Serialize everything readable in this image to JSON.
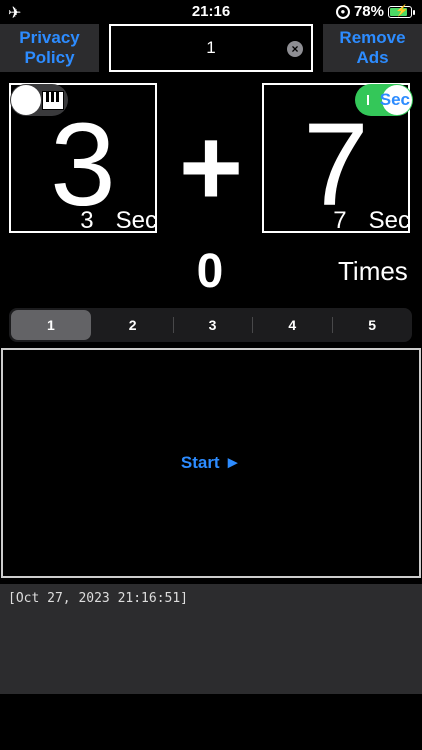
{
  "status_bar": {
    "time": "21:16",
    "battery_percent": "78%"
  },
  "header": {
    "privacy_label": "Privacy Policy",
    "remove_ads_label": "Remove Ads",
    "field_value": "1"
  },
  "left_panel": {
    "number": "3",
    "sub_value": "3",
    "sub_unit": "Sec"
  },
  "right_panel": {
    "number": "7",
    "sub_value": "7",
    "sub_unit": "Sec",
    "toggle_label": "Sec"
  },
  "operator": "+",
  "counter": {
    "value": "0",
    "label": "Times"
  },
  "segments": [
    "1",
    "2",
    "3",
    "4",
    "5"
  ],
  "selected_segment": "1",
  "start_label": "Start ►",
  "log": "[Oct 27, 2023 21:16:51]",
  "colors": {
    "accent": "#2d8cff",
    "toggle_on": "#34c759",
    "button_bg": "#2c2c2e"
  }
}
